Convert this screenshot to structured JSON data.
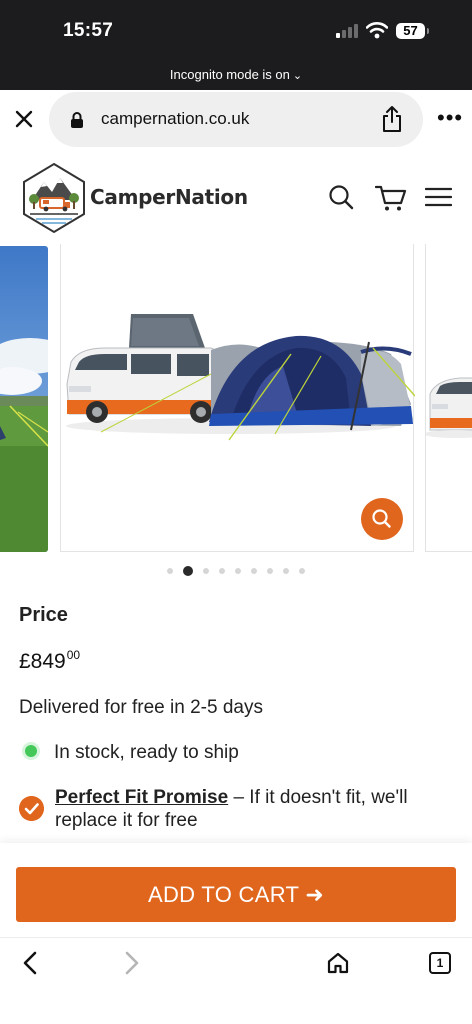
{
  "status": {
    "time": "15:57",
    "battery": "57"
  },
  "browser": {
    "incognito_text": "Incognito mode is on",
    "url": "campernation.co.uk",
    "tabs_count": "1"
  },
  "site": {
    "brand": "CamperNation"
  },
  "gallery": {
    "total_images": 9,
    "active_index": 1
  },
  "product": {
    "price_label": "Price",
    "price_main": "£849",
    "price_pence": "00",
    "delivery": "Delivered for free in 2-5 days",
    "stock": "In stock, ready to ship",
    "promise_link": "Perfect Fit Promise",
    "promise_text": " – If it doesn't fit, we'll replace it for free"
  },
  "cart": {
    "button_label": "ADD TO CART ➜"
  },
  "colors": {
    "accent": "#e0661e",
    "stock_green": "#44c85a",
    "dark_bar": "#1c1c1e"
  }
}
